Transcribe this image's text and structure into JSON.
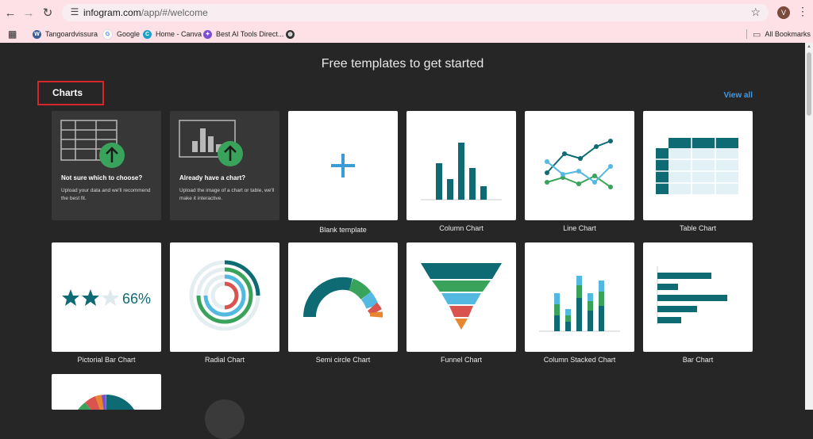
{
  "browser": {
    "url_host": "infogram.com",
    "url_path": "/app/#/welcome",
    "profile_initial": "V",
    "bookmarks": [
      "Tangoardvissura",
      "Google",
      "Home - Canva",
      "Best AI Tools Direct..."
    ],
    "all_bookmarks_label": "All Bookmarks"
  },
  "page": {
    "title": "Free templates to get started",
    "section_heading": "Charts",
    "view_all_label": "View all"
  },
  "cards": {
    "not_sure_title": "Not sure which to choose?",
    "not_sure_desc": "Upload your data and we'll recommend the best fit.",
    "have_chart_title": "Already have a chart?",
    "have_chart_desc": "Upload the image of a chart or table, we'll make it interactive.",
    "labels": [
      "Blank template",
      "Column Chart",
      "Line Chart",
      "Table Chart",
      "Pictorial Bar Chart",
      "Radial Chart",
      "Semi circle Chart",
      "Funnel Chart",
      "Column Stacked Chart",
      "Bar Chart"
    ],
    "pictorial_value": "66%"
  },
  "colors": {
    "teal": "#0e6b73",
    "green": "#3aa35b",
    "light_blue": "#54b9e1",
    "red": "#d9534f",
    "orange": "#e8862d",
    "link_blue": "#3d9be9"
  },
  "icons": {
    "upload": "up-arrow-circle-icon",
    "blank": "plus-icon"
  }
}
